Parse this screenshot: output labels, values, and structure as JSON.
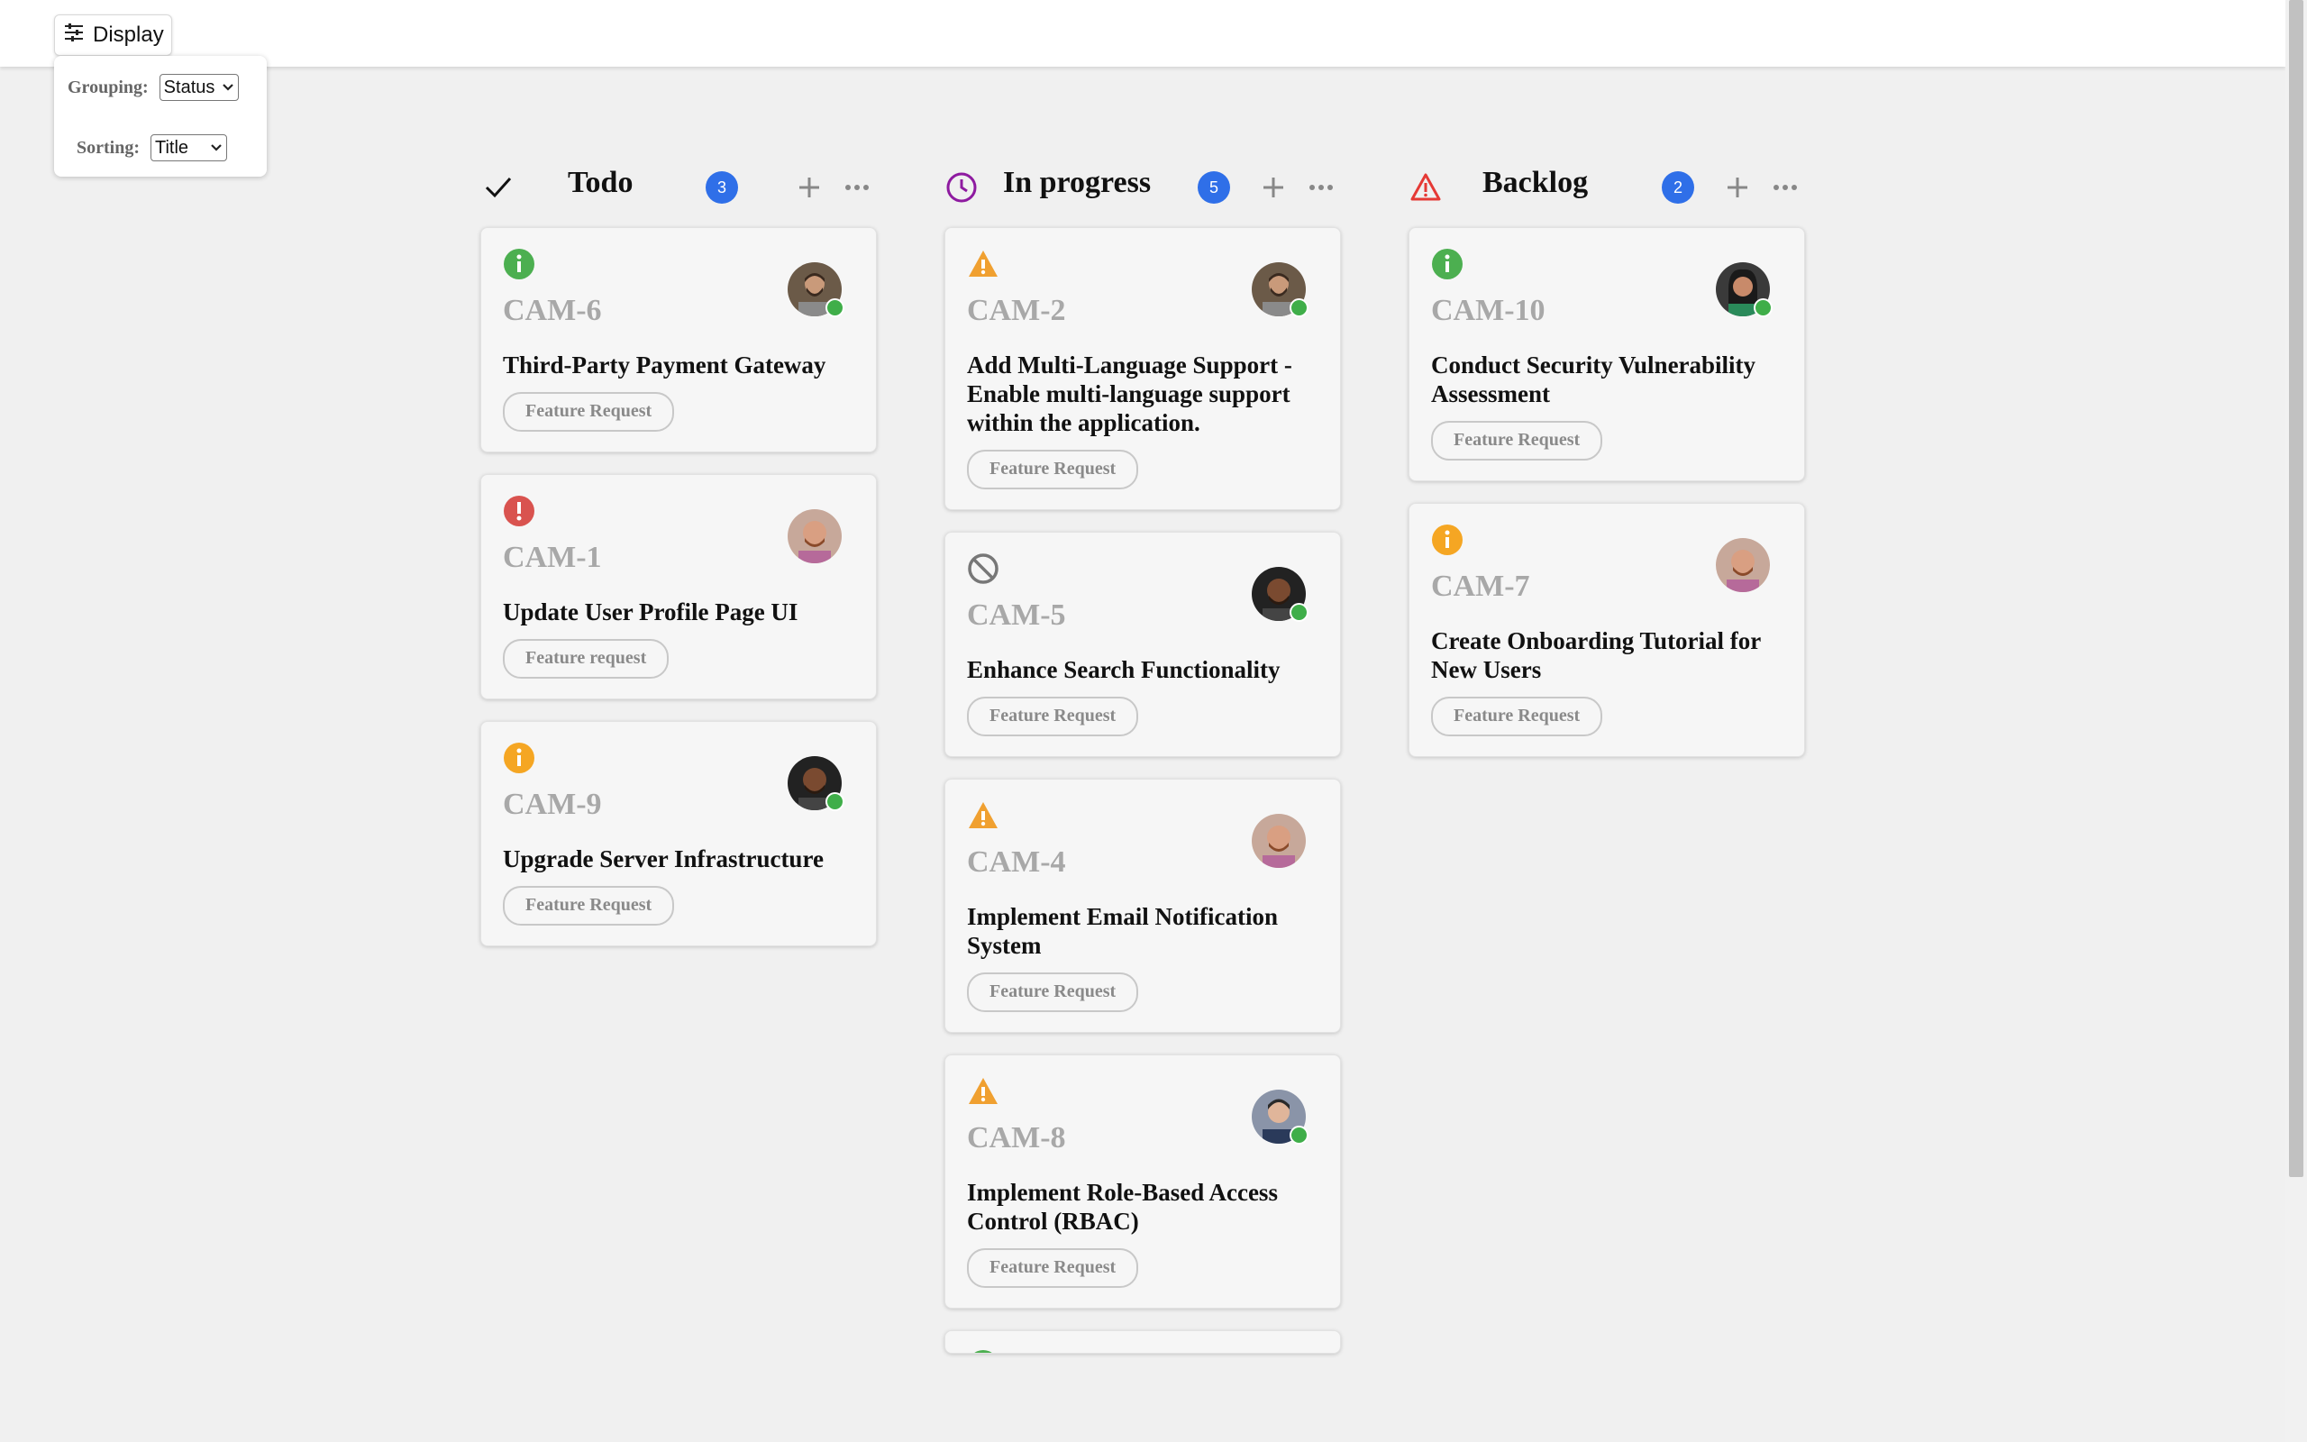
{
  "toolbar": {
    "display_label": "Display",
    "grouping_label": "Grouping:",
    "grouping_value": "Status",
    "sorting_label": "Sorting:",
    "sorting_value": "Title"
  },
  "columns": [
    {
      "title": "Todo",
      "icon": "check-icon",
      "count": "3",
      "cards": [
        {
          "id": "CAM-6",
          "title": "Third-Party Payment Gateway",
          "tag": "Feature Request",
          "priority": "info-green"
        },
        {
          "id": "CAM-1",
          "title": "Update User Profile Page UI",
          "tag": "Feature request",
          "priority": "urgent-red"
        },
        {
          "id": "CAM-9",
          "title": "Upgrade Server Infrastructure",
          "tag": "Feature Request",
          "priority": "info-orange"
        }
      ]
    },
    {
      "title": "In progress",
      "icon": "clock-icon",
      "count": "5",
      "cards": [
        {
          "id": "CAM-2",
          "title": "Add Multi-Language Support - Enable multi-language support within the application.",
          "tag": "Feature Request",
          "priority": "warning-orange"
        },
        {
          "id": "CAM-5",
          "title": "Enhance Search Functionality",
          "tag": "Feature Request",
          "priority": "no-priority"
        },
        {
          "id": "CAM-4",
          "title": "Implement Email Notification System",
          "tag": "Feature Request",
          "priority": "warning-orange"
        },
        {
          "id": "CAM-8",
          "title": "Implement Role-Based Access Control (RBAC)",
          "tag": "Feature Request",
          "priority": "warning-orange"
        }
      ]
    },
    {
      "title": "Backlog",
      "icon": "warning-red-icon",
      "count": "2",
      "cards": [
        {
          "id": "CAM-10",
          "title": "Conduct Security Vulnerability Assessment",
          "tag": "Feature Request",
          "priority": "info-green"
        },
        {
          "id": "CAM-7",
          "title": "Create Onboarding Tutorial for New Users",
          "tag": "Feature Request",
          "priority": "info-orange"
        }
      ]
    }
  ],
  "colors": {
    "count_badge": "#2f6fe8",
    "online": "#3fae49",
    "info_green": "#4caf50",
    "info_orange": "#f5a623",
    "urgent_red": "#d9534f",
    "warning_orange": "#f0a030",
    "backlog_red": "#e53935",
    "progress_purple": "#8e1aa0"
  }
}
